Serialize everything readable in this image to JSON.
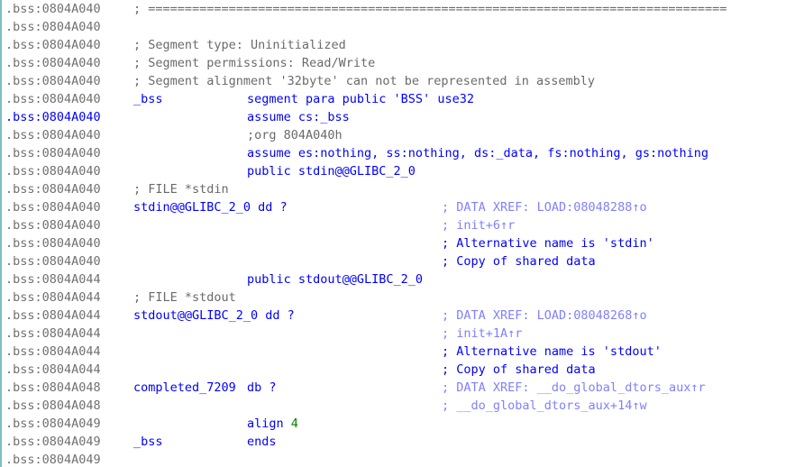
{
  "lines": [
    {
      "addr": ".bss:0804A040",
      "active": false,
      "c1": "; ===============================================================================",
      "c1_class": "sep"
    },
    {
      "addr": ".bss:0804A040",
      "active": false
    },
    {
      "addr": ".bss:0804A040",
      "active": false,
      "c1": "; Segment type: Uninitialized",
      "c1_class": "cmt"
    },
    {
      "addr": ".bss:0804A040",
      "active": false,
      "c1": "; Segment permissions: Read/Write",
      "c1_class": "cmt"
    },
    {
      "addr": ".bss:0804A040",
      "active": false,
      "c1": "; Segment alignment '32byte' can not be represented in assembly",
      "c1_class": "cmt"
    },
    {
      "addr": ".bss:0804A040",
      "active": false,
      "c1": "_bss",
      "c1_class": "name",
      "c2": "segment para public 'BSS' use32",
      "c2_class": "kw"
    },
    {
      "addr": ".bss:0804A040",
      "active": true,
      "c2": "assume cs:_bss",
      "c2_class": "kw"
    },
    {
      "addr": ".bss:0804A040",
      "active": false,
      "c2": ";org 804A040h",
      "c2_class": "cmt"
    },
    {
      "addr": ".bss:0804A040",
      "active": false,
      "c2": "assume es:nothing, ss:nothing, ds:_data, fs:nothing, gs:nothing",
      "c2_class": "kw"
    },
    {
      "addr": ".bss:0804A040",
      "active": false,
      "c2": "public stdin@@GLIBC_2_0",
      "c2_class": "kw"
    },
    {
      "addr": ".bss:0804A040",
      "active": false,
      "c1": "; FILE *stdin",
      "c1_class": "cmt"
    },
    {
      "addr": ".bss:0804A040",
      "active": false,
      "c1": "stdin@@GLIBC_2_0 dd ?",
      "c1_class": "name",
      "c3": "; DATA XREF: LOAD:08048288↑o",
      "c3_class": "xref"
    },
    {
      "addr": ".bss:0804A040",
      "active": false,
      "c3": "; init+6↑r",
      "c3_class": "xref"
    },
    {
      "addr": ".bss:0804A040",
      "active": false,
      "c3": "; Alternative name is 'stdin'",
      "c3_class": "note"
    },
    {
      "addr": ".bss:0804A040",
      "active": false,
      "c3": "; Copy of shared data",
      "c3_class": "note"
    },
    {
      "addr": ".bss:0804A044",
      "active": false,
      "c2": "public stdout@@GLIBC_2_0",
      "c2_class": "kw"
    },
    {
      "addr": ".bss:0804A044",
      "active": false,
      "c1": "; FILE *stdout",
      "c1_class": "cmt"
    },
    {
      "addr": ".bss:0804A044",
      "active": false,
      "c1": "stdout@@GLIBC_2_0 dd ?",
      "c1_class": "name",
      "c3": "; DATA XREF: LOAD:08048268↑o",
      "c3_class": "xref"
    },
    {
      "addr": ".bss:0804A044",
      "active": false,
      "c3": "; init+1A↑r",
      "c3_class": "xref"
    },
    {
      "addr": ".bss:0804A044",
      "active": false,
      "c3": "; Alternative name is 'stdout'",
      "c3_class": "note"
    },
    {
      "addr": ".bss:0804A044",
      "active": false,
      "c3": "; Copy of shared data",
      "c3_class": "note"
    },
    {
      "addr": ".bss:0804A048",
      "active": false,
      "c1": "completed_7209",
      "c1_class": "name",
      "c2": "db ?",
      "c2_class": "kw",
      "c3": "; DATA XREF: __do_global_dtors_aux↑r",
      "c3_class": "xref"
    },
    {
      "addr": ".bss:0804A048",
      "active": false,
      "c3": "; __do_global_dtors_aux+14↑w",
      "c3_class": "xref"
    },
    {
      "addr": ".bss:0804A049",
      "active": false,
      "c2": "align",
      "c2_class": "kw",
      "c2_num": "4"
    },
    {
      "addr": ".bss:0804A049",
      "active": false,
      "c1": "_bss",
      "c1_class": "name",
      "c2": "ends",
      "c2_class": "kw"
    },
    {
      "addr": ".bss:0804A049",
      "active": false
    }
  ]
}
